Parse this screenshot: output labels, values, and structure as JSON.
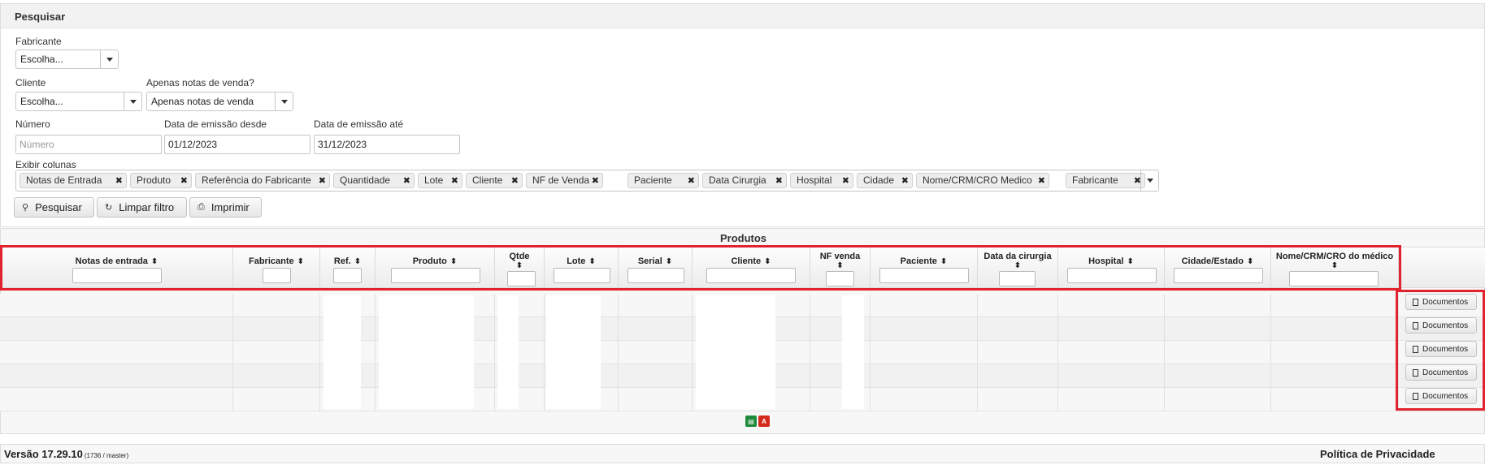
{
  "search": {
    "title": "Pesquisar",
    "fabricante": {
      "label": "Fabricante",
      "value": "Escolha..."
    },
    "cliente": {
      "label": "Cliente",
      "value": "Escolha..."
    },
    "apenas_notas": {
      "label": "Apenas notas de venda?",
      "value": "Apenas notas de venda"
    },
    "numero": {
      "label": "Número",
      "placeholder": "Número"
    },
    "data_desde": {
      "label": "Data de emissão desde",
      "value": "01/12/2023"
    },
    "data_ate": {
      "label": "Data de emissão até",
      "value": "31/12/2023"
    },
    "exibir_colunas": {
      "label": "Exibir colunas",
      "tags": [
        "Notas de Entrada",
        "Produto",
        "Referência do Fabricante",
        "Quantidade",
        "Lote",
        "Cliente",
        "NF de Venda",
        "Paciente",
        "Data Cirurgia",
        "Hospital",
        "Cidade",
        "Nome/CRM/CRO Medico",
        "Fabricante"
      ]
    },
    "buttons": {
      "pesquisar": "Pesquisar",
      "limpar": "Limpar filtro",
      "imprimir": "Imprimir"
    }
  },
  "produtos": {
    "title": "Produtos",
    "columns": [
      {
        "label": "Notas de entrada"
      },
      {
        "label": "Fabricante"
      },
      {
        "label": "Ref."
      },
      {
        "label": "Produto"
      },
      {
        "label": "Qtde"
      },
      {
        "label": "Lote"
      },
      {
        "label": "Serial"
      },
      {
        "label": "Cliente"
      },
      {
        "label": "NF venda"
      },
      {
        "label": "Paciente"
      },
      {
        "label": "Data da cirurgia"
      },
      {
        "label": "Hospital"
      },
      {
        "label": "Cidade/Estado"
      },
      {
        "label": "Nome/CRM/CRO do médico"
      }
    ],
    "row_button": "Documentos",
    "row_count": 5,
    "export_icons": [
      "spreadsheet-icon",
      "pdf-icon"
    ]
  },
  "footer": {
    "version": "Versão 17.29.10",
    "build": "(1736 / master)",
    "privacy": "Política de Privacidade"
  },
  "colors": {
    "highlight": "#e1232f",
    "excel": "#1f8a3b",
    "pdf": "#d32a1d"
  }
}
